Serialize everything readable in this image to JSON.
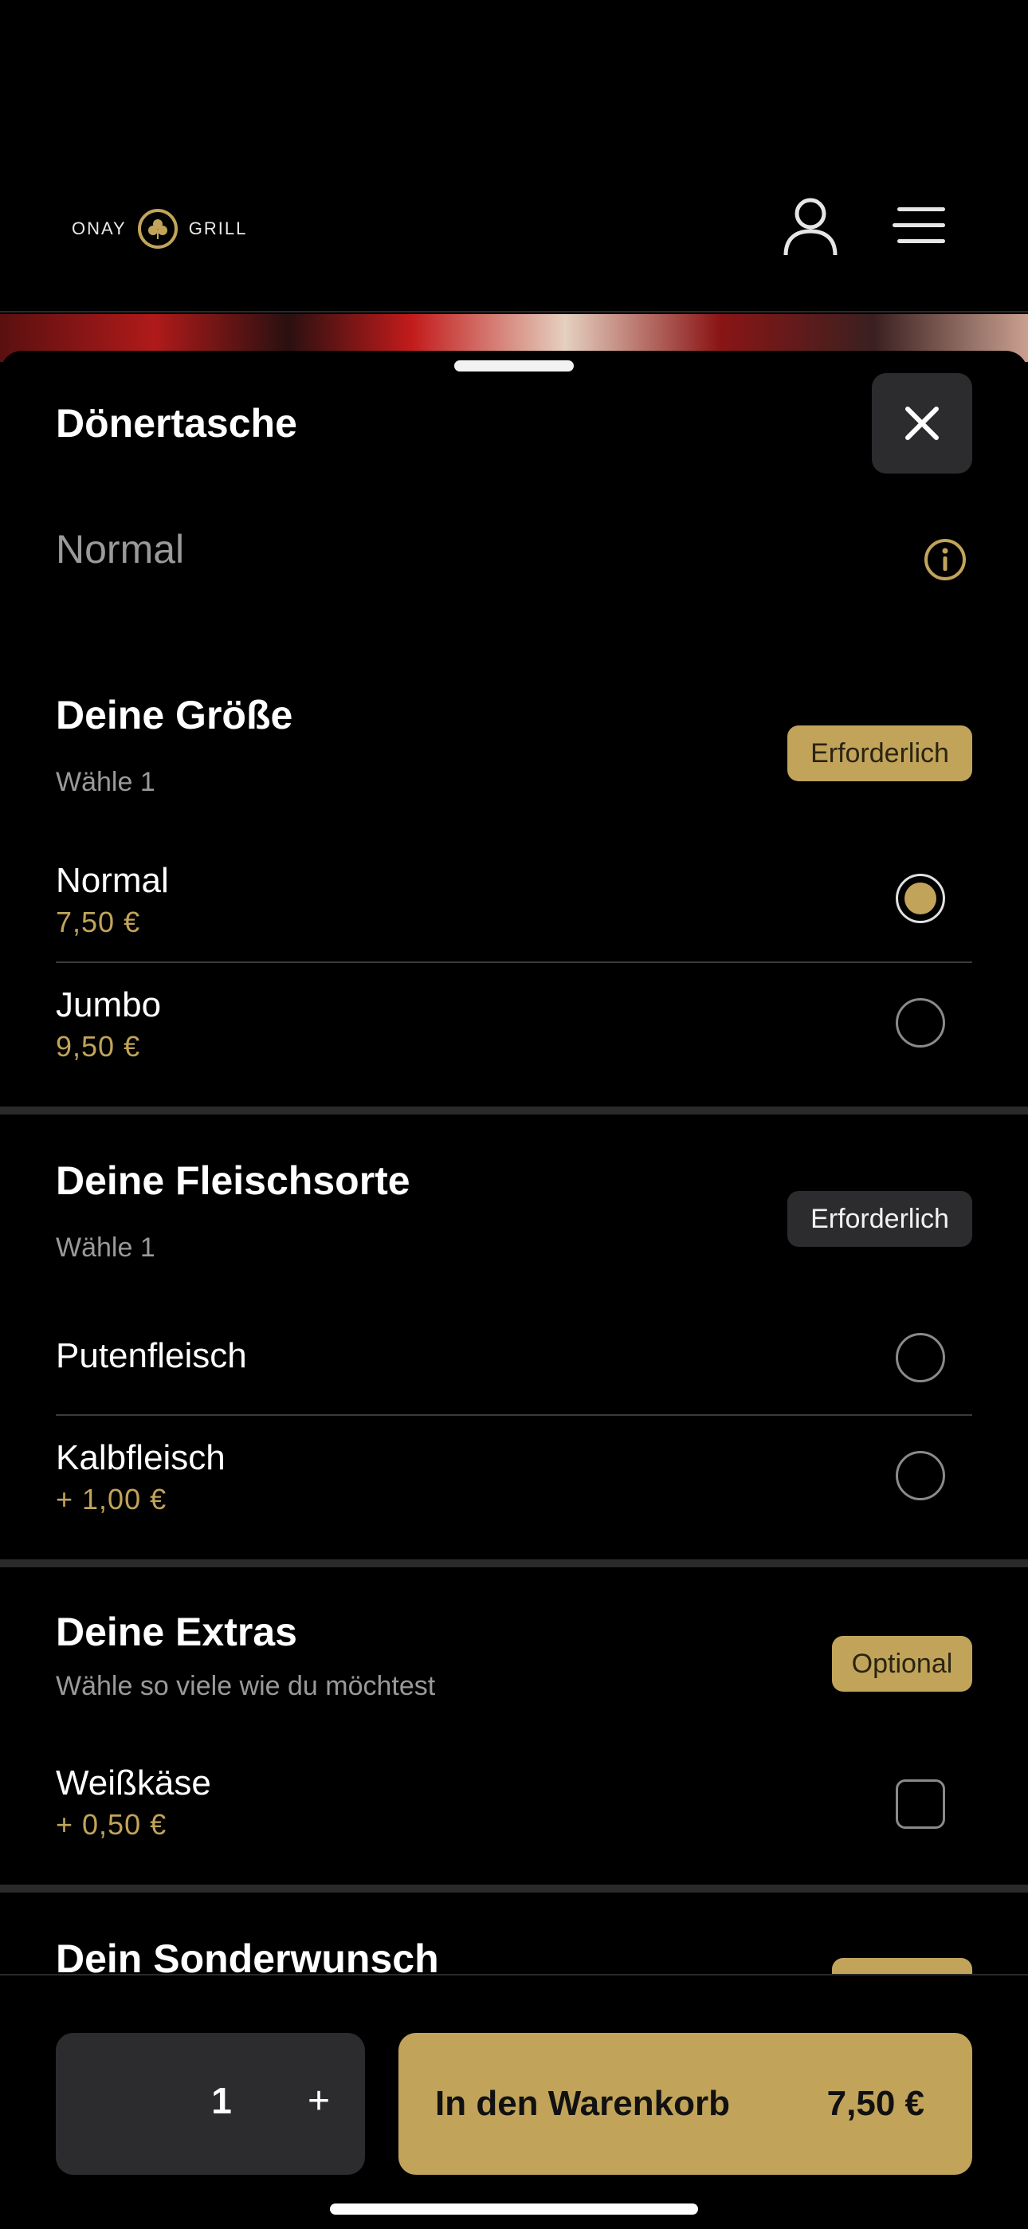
{
  "header": {
    "logo_left": "ONAY",
    "logo_right": "GRILL",
    "icons": [
      "user-icon",
      "menu-icon",
      "clover-icon"
    ]
  },
  "sheet": {
    "title": "Dönertasche",
    "subtitle": "Normal",
    "close_icon": "close-icon",
    "info_icon": "info-icon"
  },
  "sections": {
    "size": {
      "title": "Deine Größe",
      "hint": "Wähle 1",
      "badge": "Erforderlich",
      "options": [
        {
          "name": "Normal",
          "price": "7,50 €",
          "selected": true
        },
        {
          "name": "Jumbo",
          "price": "9,50 €",
          "selected": false
        }
      ]
    },
    "meat": {
      "title": "Deine Fleischsorte",
      "hint": "Wähle 1",
      "badge": "Erforderlich",
      "options": [
        {
          "name": "Putenfleisch",
          "price": "",
          "selected": false
        },
        {
          "name": "Kalbfleisch",
          "price": "+ 1,00 €",
          "selected": false
        }
      ]
    },
    "extras": {
      "title": "Deine Extras",
      "hint": "Wähle so viele wie du möchtest",
      "badge": "Optional",
      "options": [
        {
          "name": "Weißkäse",
          "price": "+ 0,50 €",
          "checked": false
        }
      ]
    },
    "special": {
      "title": "Dein Sonderwunsch"
    }
  },
  "bottom": {
    "quantity": "1",
    "plus": "+",
    "cart_label": "In den Warenkorb",
    "cart_price": "7,50 €"
  },
  "colors": {
    "accent": "#c1a45a",
    "background": "#000000",
    "surface": "#2c2c2e"
  }
}
